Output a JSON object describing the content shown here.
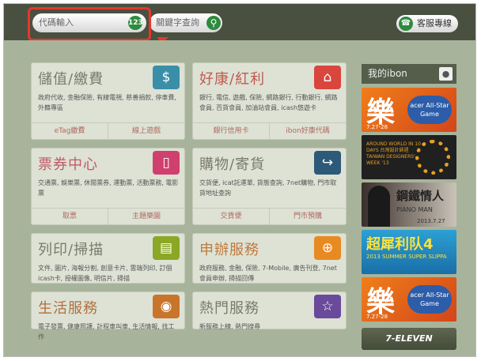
{
  "topbar": {
    "code_placeholder": "代碼輸入",
    "code_button": "123",
    "keyword_placeholder": "關鍵字查詢",
    "service_label": "客服專線"
  },
  "cards": [
    {
      "title": "儲值/繳費",
      "icon": "dollar-icon",
      "color": "#3a8ea8",
      "desc": "政府代收, 金融保險, 有線電視, 慈善捐款, 停車費, 外籍專區",
      "links": [
        "eTag繳費",
        "線上遊戲"
      ]
    },
    {
      "title": "好康/紅利",
      "icon": "house-icon",
      "color": "#d9463e",
      "desc": "銀行, 電信, 遊戲, 保險, 網路銀行, 行動銀行, 網路會員, 百貨會員, 加油站會員, icash悠遊卡",
      "links": [
        "銀行信用卡",
        "ibon好康代碼"
      ]
    },
    {
      "title": "票券中心",
      "icon": "ticket-icon",
      "color": "#d0406e",
      "desc": "交通票, 娛樂票, 休閒票券, 運動票, 活動票務, 電影票",
      "links": [
        "取票",
        "主題樂園"
      ]
    },
    {
      "title": "購物/寄貨",
      "icon": "export-icon",
      "color": "#2c5a78",
      "desc": "交貨便, icat託運單, 貨態查詢, 7net購物, 門市取貨地址查詢",
      "links": [
        "交貨便",
        "門市預購"
      ]
    },
    {
      "title": "列印/掃描",
      "icon": "document-icon",
      "color": "#8aa826",
      "desc": "文件, 圖片, 海報分割, 創意卡片, 雲端列印, 訂個icash卡, 授權圖像, 明信片, 掃描",
      "links": []
    },
    {
      "title": "申辦服務",
      "icon": "plus-icon",
      "color": "#e88a22",
      "desc": "政府服務, 金融, 保險, 7-Mobile, 廣告刊登, 7net會員申辦, 掃描回傳",
      "links": []
    },
    {
      "title": "生活服務",
      "icon": "location-pin-icon",
      "color": "#c8742a",
      "desc": "電子發票, 健康照護, 計程車叫車, 生活情報, 找工作",
      "links": []
    },
    {
      "title": "熱門服務",
      "icon": "star-icon",
      "color": "#6a4a9a",
      "desc": "新服務上線, 熱門搜尋",
      "links": []
    }
  ],
  "sidebar": {
    "header": "我的ibon",
    "banners": [
      {
        "big": "樂",
        "logo": "acer All-Star Game",
        "date": "7.27-28"
      },
      {
        "text": "AROUND WORLD IN 10 DAYS 台灣設計師週 TAIWAN DESIGNERS' WEEK '13"
      },
      {
        "title": "鋼鐵情人",
        "sub": "PIANO MAN",
        "date": "2013.7.27"
      },
      {
        "title": "超犀利队4",
        "sub": "2013 SUMMER SUPER SLIPPA"
      },
      {
        "big": "樂",
        "logo": "acer All-Star Game",
        "date": "7.27-28"
      }
    ],
    "footer": "7-ELEVEN"
  }
}
